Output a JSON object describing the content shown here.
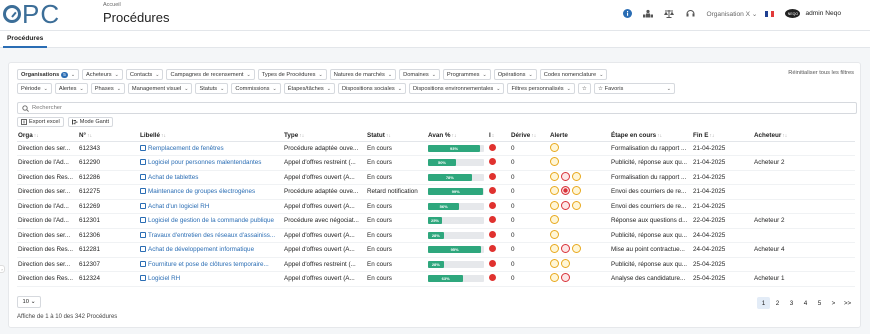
{
  "app": {
    "logo_text": "PC",
    "breadcrumb": "Accueil",
    "title": "Procédures"
  },
  "topbar": {
    "organisation": "Organisation X",
    "user": "admin Neqo",
    "avatar_text": "NEQO"
  },
  "tabs": [
    {
      "label": "Procédures"
    }
  ],
  "filters": {
    "row1": [
      {
        "label": "Organisations",
        "badge": "5"
      },
      {
        "label": "Acheteurs"
      },
      {
        "label": "Contacts"
      },
      {
        "label": "Campagnes de recensement"
      },
      {
        "label": "Types de Procédures"
      },
      {
        "label": "Natures de marchés"
      },
      {
        "label": "Domaines"
      },
      {
        "label": "Programmes"
      },
      {
        "label": "Opérations"
      },
      {
        "label": "Codes nomenclature"
      }
    ],
    "row2": [
      {
        "label": "Période"
      },
      {
        "label": "Alertes"
      },
      {
        "label": "Phases"
      },
      {
        "label": "Management visuel"
      },
      {
        "label": "Statuts"
      },
      {
        "label": "Commissions"
      },
      {
        "label": "Étapes/tâches"
      },
      {
        "label": "Dispositions sociales"
      },
      {
        "label": "Dispositions environnementales"
      },
      {
        "label": "Filtres personnalisés"
      }
    ],
    "favorites_label": "Favoris",
    "reset_label": "Réinitialiser tous les filtres"
  },
  "search": {
    "placeholder": "Rechercher"
  },
  "actions": {
    "export": "Export excel",
    "gantt": "Mode Gantt"
  },
  "table": {
    "columns": [
      "Orga",
      "N°",
      "Libellé",
      "Type",
      "Statut",
      "Avan %",
      "I",
      "Dérive",
      "Alerte",
      "Étape en cours",
      "Fin E",
      "Acheteur"
    ],
    "rows": [
      {
        "orga": "Direction des ser...",
        "num": "612343",
        "libelle": "Remplacement de fenêtres",
        "type": "Procédure adaptée ouve...",
        "statut": "En cours",
        "progress": 93,
        "derive": "0",
        "alerts": [
          "yellow"
        ],
        "etape": "Formalisation du rapport ...",
        "fin": "21-04-2025",
        "acheteur": ""
      },
      {
        "orga": "Direction de l'Ad...",
        "num": "612290",
        "libelle": "Logiciel pour personnes malentendantes",
        "type": "Appel d'offres restreint (...",
        "statut": "En cours",
        "progress": 50,
        "derive": "0",
        "alerts": [
          "yellow"
        ],
        "etape": "Publicité, réponse aux qu...",
        "fin": "21-04-2025",
        "acheteur": "Acheteur 2"
      },
      {
        "orga": "Direction des Res...",
        "num": "612286",
        "libelle": "Achat de tablettes",
        "type": "Appel d'offres ouvert (A...",
        "statut": "En cours",
        "progress": 78,
        "derive": "0",
        "alerts": [
          "yellow",
          "red",
          "yellow"
        ],
        "etape": "Formalisation du rapport ...",
        "fin": "21-04-2025",
        "acheteur": ""
      },
      {
        "orga": "Direction des ser...",
        "num": "612275",
        "libelle": "Maintenance de groupes électrogènes",
        "type": "Procédure adaptée ouve...",
        "statut": "Retard notification",
        "progress": 99,
        "derive": "0",
        "alerts": [
          "yellow",
          "red-filled",
          "yellow"
        ],
        "etape": "Envoi des courriers de re...",
        "fin": "21-04-2025",
        "acheteur": ""
      },
      {
        "orga": "Direction de l'Ad...",
        "num": "612269",
        "libelle": "Achat d'un logiciel RH",
        "type": "Appel d'offres ouvert (A...",
        "statut": "En cours",
        "progress": 56,
        "derive": "0",
        "alerts": [
          "yellow",
          "red",
          "yellow"
        ],
        "etape": "Envoi des courriers de re...",
        "fin": "21-04-2025",
        "acheteur": ""
      },
      {
        "orga": "Direction de l'Ad...",
        "num": "612301",
        "libelle": "Logiciel de gestion de la commande publique",
        "type": "Procédure avec négociat...",
        "statut": "En cours",
        "progress": 25,
        "derive": "0",
        "alerts": [
          "yellow"
        ],
        "etape": "Réponse aux questions d...",
        "fin": "22-04-2025",
        "acheteur": "Acheteur 2"
      },
      {
        "orga": "Direction des ser...",
        "num": "612306",
        "libelle": "Travaux d'entretien des réseaux d'assainiss...",
        "type": "Appel d'offres ouvert (A...",
        "statut": "En cours",
        "progress": 28,
        "derive": "0",
        "alerts": [
          "yellow"
        ],
        "etape": "Publicité, réponse aux qu...",
        "fin": "24-04-2025",
        "acheteur": ""
      },
      {
        "orga": "Direction des Res...",
        "num": "612281",
        "libelle": "Achat de développement informatique",
        "type": "Appel d'offres ouvert (A...",
        "statut": "En cours",
        "progress": 95,
        "derive": "0",
        "alerts": [
          "yellow",
          "red",
          "yellow"
        ],
        "etape": "Mise au point contractue...",
        "fin": "24-04-2025",
        "acheteur": "Acheteur 4"
      },
      {
        "orga": "Direction des ser...",
        "num": "612307",
        "libelle": "Fourniture et pose de clôtures temporaire...",
        "type": "Appel d'offres restreint (...",
        "statut": "En cours",
        "progress": 28,
        "derive": "0",
        "alerts": [
          "yellow",
          "yellow"
        ],
        "etape": "Publicité, réponse aux qu...",
        "fin": "25-04-2025",
        "acheteur": ""
      },
      {
        "orga": "Direction des Res...",
        "num": "612324",
        "libelle": "Logiciel RH",
        "type": "Appel d'offres ouvert (A...",
        "statut": "En cours",
        "progress": 63,
        "derive": "0",
        "alerts": [
          "yellow",
          "red"
        ],
        "etape": "Analyse des candidature...",
        "fin": "25-04-2025",
        "acheteur": "Acheteur 1"
      }
    ]
  },
  "pagination": {
    "page_size": "10",
    "info": "Affiche de 1 à 10 des 342 Procédures",
    "pages": [
      "1",
      "2",
      "3",
      "4",
      "5",
      ">",
      ">>"
    ],
    "current": "1"
  },
  "colors": {
    "accent": "#2a6db4",
    "progress": "#2ea77d",
    "alert_red": "#e0322f",
    "alert_yellow": "#e8a91e"
  }
}
